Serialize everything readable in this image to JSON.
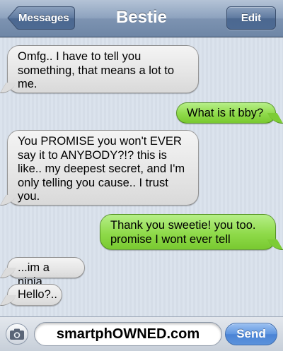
{
  "header": {
    "back_label": "Messages",
    "title": "Bestie",
    "edit_label": "Edit"
  },
  "messages": [
    {
      "direction": "incoming",
      "text": "Omfg.. I have to tell you something, that means a lot to me."
    },
    {
      "direction": "outgoing",
      "text": "What is it bby?"
    },
    {
      "direction": "incoming",
      "text": "You PROMISE you won't EVER say it to ANYBODY?!? this is like.. my deepest secret, and I'm only telling you cause.. I trust you."
    },
    {
      "direction": "outgoing",
      "text": "Thank you sweetie! you too. promise I wont ever tell"
    },
    {
      "direction": "incoming",
      "text": "...im a ninja"
    },
    {
      "direction": "incoming",
      "text": "Hello?.."
    }
  ],
  "composer": {
    "camera_icon": "camera-icon",
    "input_value": "smartphOWNED.com",
    "send_label": "Send"
  },
  "colors": {
    "incoming_bubble": "#e6e6e6",
    "outgoing_bubble": "#8fda4a",
    "navbar": "#7d93b1",
    "send_button": "#4a83d5"
  }
}
